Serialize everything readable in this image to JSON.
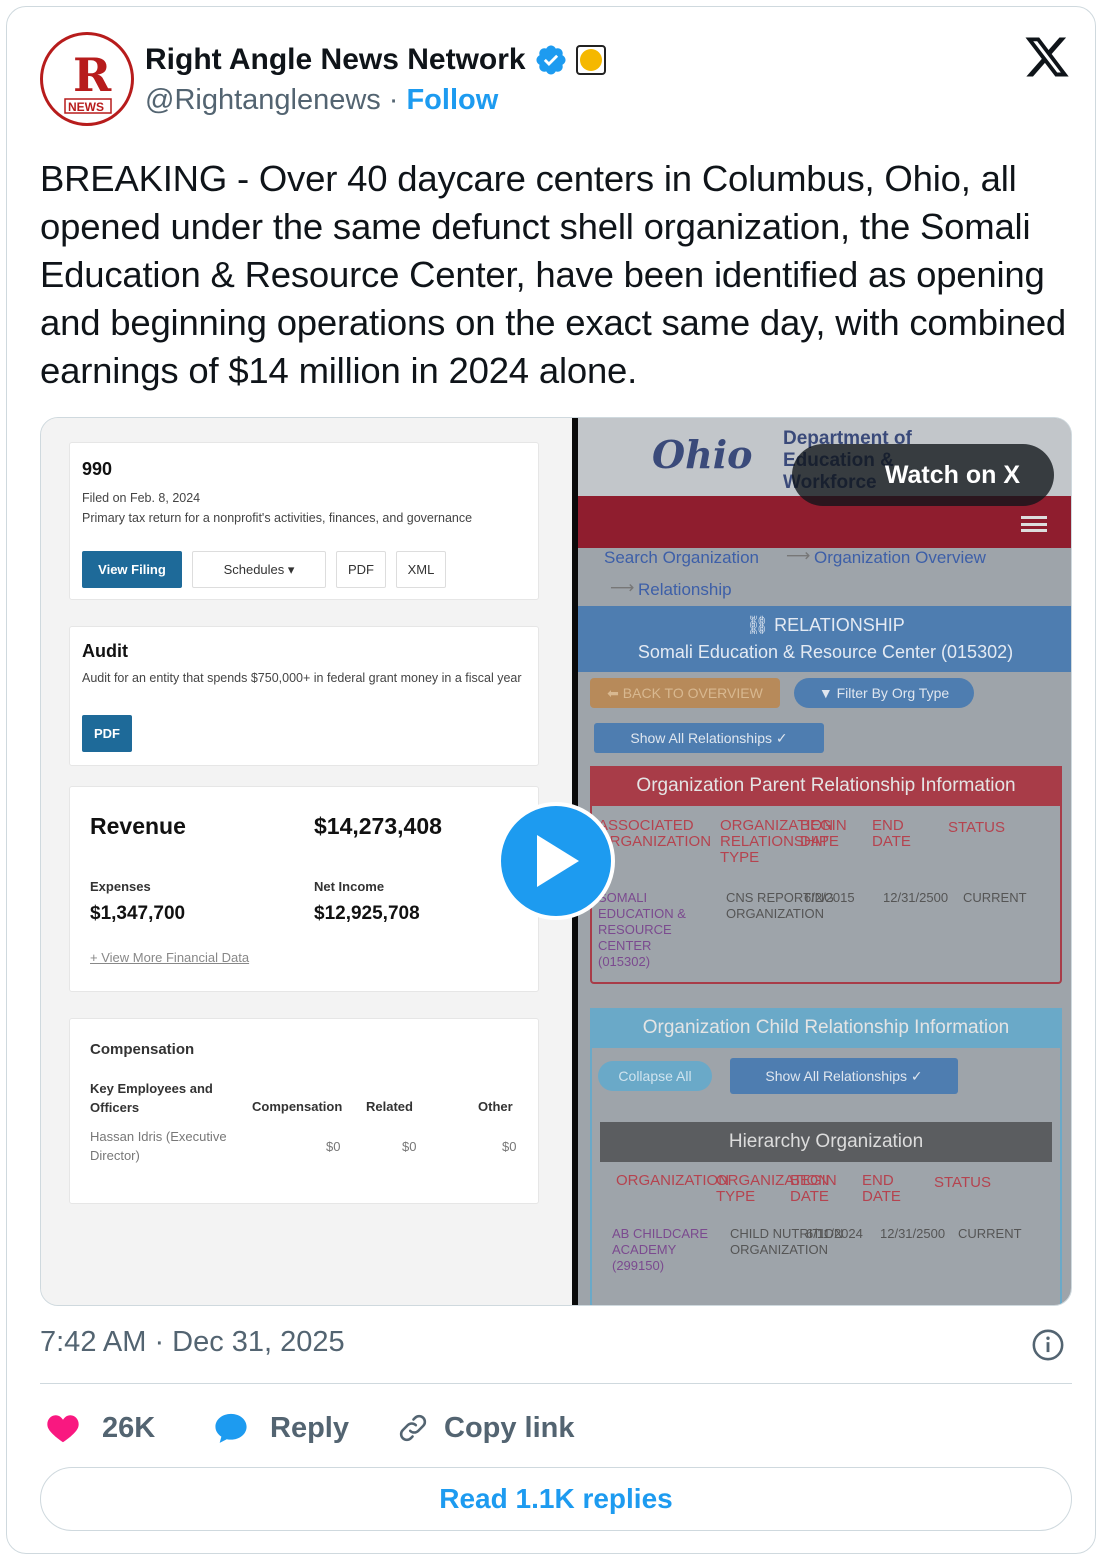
{
  "author": {
    "name": "Right Angle News Network",
    "handle": "@Rightanglenews",
    "separator": "·",
    "follow_label": "Follow",
    "avatar_letter": "R",
    "avatar_text": "NEWS"
  },
  "tweet": {
    "text": "BREAKING - Over 40 daycare centers in Columbus, Ohio, all opened under the same defunct shell organization, the Somali Education & Resource Center, have been identified as opening and beginning operations on the exact same day, with combined earnings of $14 million in 2024 alone.",
    "timestamp": "7:42 AM · Dec 31, 2025"
  },
  "media": {
    "watch_label": "Watch on X",
    "left": {
      "form_title": "990",
      "filed": "Filed on Feb. 8, 2024",
      "form_desc": "Primary tax return for a nonprofit's activities, finances, and governance",
      "view_filing": "View Filing",
      "schedules": "Schedules ▾",
      "pdf": "PDF",
      "xml": "XML",
      "audit_title": "Audit",
      "audit_desc": "Audit for an entity that spends $750,000+ in federal grant money in a fiscal year",
      "audit_pdf": "PDF",
      "revenue_label": "Revenue",
      "revenue_value": "$14,273,408",
      "expenses_label": "Expenses",
      "expenses_value": "$1,347,700",
      "net_label": "Net Income",
      "net_value": "$12,925,708",
      "more_link": "+ View More Financial Data",
      "comp_title": "Compensation",
      "comp_col1": "Key Employees and Officers",
      "comp_col2": "Compensation",
      "comp_col3": "Related",
      "comp_col4": "Other",
      "comp_name": "Hassan Idris (Executive Director)",
      "comp_v1": "$0",
      "comp_v2": "$0",
      "comp_v3": "$0"
    },
    "right": {
      "ohio": "Ohio",
      "dept": "Department of Education & Workforce",
      "crumb1": "Search Organization",
      "crumb2": "Organization Overview",
      "crumb3": "Relationship",
      "rel_title": "RELATIONSHIP",
      "rel_org": "Somali Education & Resource Center (015302)",
      "back": "BACK TO OVERVIEW",
      "filter": "Filter By Org Type",
      "show_all": "Show All Relationships ✓",
      "parent_head": "Organization Parent Relationship Information",
      "ph_col1": "ASSOCIATED ORGANIZATION",
      "ph_col2": "ORGANIZATION RELATIONSHIP TYPE",
      "ph_col3": "BEGIN DATE",
      "ph_col4": "END DATE",
      "ph_col5": "STATUS",
      "pr_org": "SOMALI EDUCATION & RESOURCE CENTER (015302)",
      "pr_type": "CNS REPORTING ORGANIZATION",
      "pr_begin": "6/2/2015",
      "pr_end": "12/31/2500",
      "pr_status": "CURRENT",
      "child_head": "Organization Child Relationship Information",
      "collapse": "Collapse All",
      "show_all2": "Show All Relationships ✓",
      "hier_head": "Hierarchy Organization",
      "ch_col1": "ORGANIZATION",
      "ch_col2": "ORGANIZATION TYPE",
      "ch_col3": "BEGIN DATE",
      "ch_col4": "END DATE",
      "ch_col5": "STATUS",
      "cr_org": "AB CHILDCARE ACADEMY (299150)",
      "cr_type": "CHILD NUTRITION ORGANIZATION",
      "cr_begin": "6/11/2024",
      "cr_end": "12/31/2500",
      "cr_status": "CURRENT"
    }
  },
  "actions": {
    "likes": "26K",
    "reply": "Reply",
    "copy_link": "Copy link",
    "read_replies": "Read 1.1K replies"
  },
  "colors": {
    "accent": "#1d9bf0",
    "like": "#f91880",
    "muted": "#536471"
  }
}
